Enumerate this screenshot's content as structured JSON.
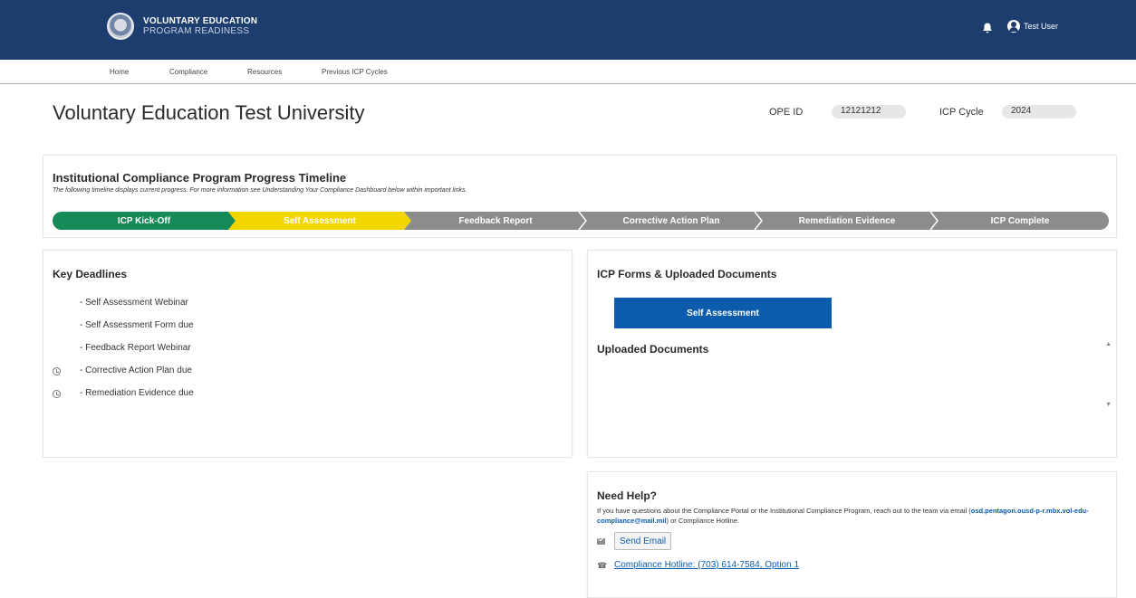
{
  "header": {
    "brand_title": "VOLUNTARY EDUCATION",
    "brand_subtitle": "PROGRAM READINESS",
    "user_name": "Test User"
  },
  "nav": {
    "items": [
      "Home",
      "Compliance",
      "Resources",
      "Previous ICP Cycles"
    ]
  },
  "page": {
    "title": "Voluntary Education Test University",
    "ope_label": "OPE ID",
    "ope_value": "12121212",
    "cycle_label": "ICP Cycle",
    "cycle_value": "2024"
  },
  "timeline": {
    "title": "Institutional Compliance Program Progress Timeline",
    "subtitle": "The following timeline displays current progress. For more information see Understanding Your Compliance Dashboard below within important links.",
    "steps": [
      {
        "label": "ICP Kick-Off",
        "status": "complete",
        "color": "#178a5a"
      },
      {
        "label": "Self Assessment",
        "status": "current",
        "color": "#f2d600"
      },
      {
        "label": "Feedback Report",
        "status": "upcoming",
        "color": "#8c8c8c"
      },
      {
        "label": "Corrective Action Plan",
        "status": "upcoming",
        "color": "#8c8c8c"
      },
      {
        "label": "Remediation Evidence",
        "status": "upcoming",
        "color": "#8c8c8c"
      },
      {
        "label": "ICP Complete",
        "status": "upcoming",
        "color": "#8c8c8c"
      }
    ]
  },
  "deadlines": {
    "title": "Key Deadlines",
    "items": [
      {
        "label": "- Self Assessment Webinar",
        "icon": ""
      },
      {
        "label": "- Self Assessment Form due",
        "icon": ""
      },
      {
        "label": "- Feedback Report Webinar",
        "icon": ""
      },
      {
        "label": "- Corrective Action Plan due",
        "icon": "clock-icon"
      },
      {
        "label": "- Remediation Evidence due",
        "icon": "clock-icon"
      }
    ]
  },
  "forms": {
    "title": "ICP Forms & Uploaded Documents",
    "self_assessment_button": "Self Assessment",
    "uploaded_title": "Uploaded Documents"
  },
  "help": {
    "title": "Need Help?",
    "text_before": "If you have questions about the Compliance Portal or the Institutional Compliance Program, reach out to the team via email (",
    "email": "osd.pentagon.ousd-p-r.mbx.vol-edu-compliance@mail.mil",
    "text_after": ") or Compliance Hotline.",
    "send_email_label": "Send Email",
    "hotline_label": "Compliance Hotline: (703) 614-7584, Option 1"
  },
  "colors": {
    "header_bg": "#1c3d6e",
    "primary_button": "#0b5cad"
  }
}
